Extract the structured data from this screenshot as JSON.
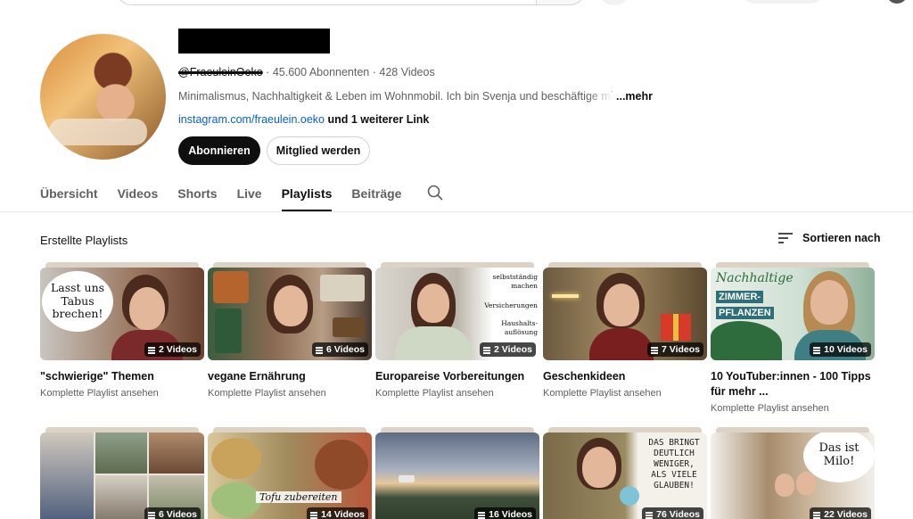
{
  "channel": {
    "handle": "@FraeuleinOeko",
    "subscribers": "45.600 Abonnenten",
    "videos": "428 Videos",
    "description": "Minimalismus, Nachhaltigkeit & Leben im Wohnmobil. Ich bin Svenja und beschäftige mi",
    "more_label": "...mehr",
    "link": "instagram.com/fraeulein.oeko",
    "extra_links": "und 1 weiterer Link",
    "subscribe_label": "Abonnieren",
    "member_label": "Mitglied werden"
  },
  "tabs": [
    {
      "label": "Übersicht",
      "active": false
    },
    {
      "label": "Videos",
      "active": false
    },
    {
      "label": "Shorts",
      "active": false
    },
    {
      "label": "Live",
      "active": false
    },
    {
      "label": "Playlists",
      "active": true
    },
    {
      "label": "Beiträge",
      "active": false
    }
  ],
  "section": {
    "title": "Erstellte Playlists",
    "sort_label": "Sortieren nach"
  },
  "playlists_row1": [
    {
      "title": "\"schwierige\" Themen",
      "count": "2 Videos",
      "sub": "Komplette Playlist ansehen",
      "thumb_text": "Lasst uns Tabus brechen!"
    },
    {
      "title": "vegane Ernährung",
      "count": "6 Videos",
      "sub": "Komplette Playlist ansehen"
    },
    {
      "title": "Europareise Vorbereitungen",
      "count": "2 Videos",
      "sub": "Komplette Playlist ansehen",
      "thumb_text": [
        "selbstständig machen",
        "Versicherungen",
        "Haushalts- auflösung"
      ]
    },
    {
      "title": "Geschenkideen",
      "count": "7 Videos",
      "sub": "Komplette Playlist ansehen"
    },
    {
      "title": "10 YouTuber:innen - 100 Tipps für mehr ...",
      "count": "10 Videos",
      "sub": "Komplette Playlist ansehen",
      "thumb_text": [
        "Nachhaltige",
        "ZIMMER-",
        "PFLANZEN"
      ]
    }
  ],
  "playlists_row2": [
    {
      "count": "6 Videos"
    },
    {
      "count": "14 Videos",
      "thumb_text": "Tofu zubereiten"
    },
    {
      "count": "16 Videos"
    },
    {
      "count": "76 Videos",
      "thumb_text": "DAS BRINGT DEUTLICH WENIGER, ALS VIELE GLAUBEN!"
    },
    {
      "count": "22 Videos",
      "thumb_text": "Das ist Milo!"
    }
  ],
  "colors": {
    "text": "#0f0f0f",
    "secondary": "#606060",
    "link": "#065fd4",
    "subscribe_bg": "#0f0f0f"
  }
}
